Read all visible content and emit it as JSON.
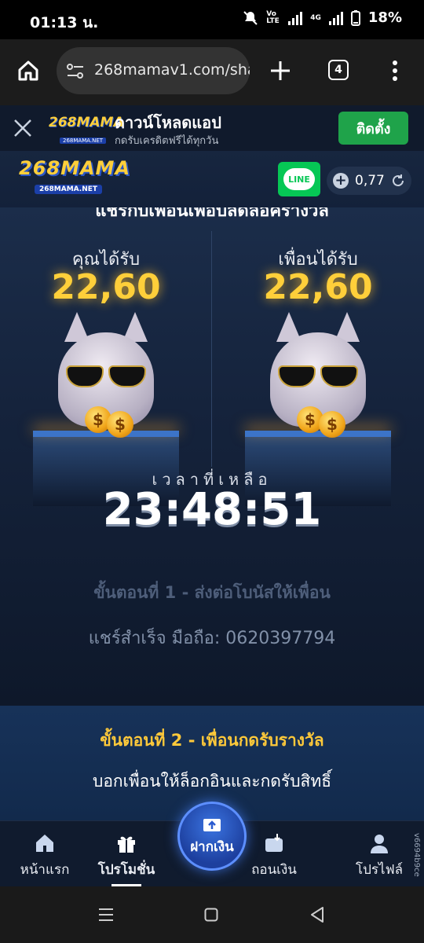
{
  "status_bar": {
    "time": "01:13 น.",
    "battery": "18%",
    "network": "4G",
    "carrier_mark": "Vo LTE"
  },
  "browser": {
    "url": "268mamav1.com/sha",
    "tab_count": "4"
  },
  "app_banner": {
    "title": "ดาวน์โหลดแอป",
    "subtitle": "กดรับเครดิตฟรีได้ทุกวัน",
    "install_label": "ติดตั้ง",
    "logo_text": "268MAMA",
    "logo_sub": "268MAMA.NET"
  },
  "header": {
    "logo_text": "268MAMA",
    "logo_sub": "268MAMA.NET",
    "line_label": "LINE",
    "balance": "0,77"
  },
  "main": {
    "cut_title": "แชร์กับเพื่อนเพื่อปลดล็อครางวัล",
    "you_label": "คุณได้รับ",
    "you_amount": "22,60",
    "friend_label": "เพื่อนได้รับ",
    "friend_amount": "22,60",
    "time_left_label": "เวลาที่เหลือ",
    "countdown": "23:48:51",
    "step1": "ขั้นตอนที่ 1 - ส่งต่อโบนัสให้เพื่อน",
    "share_status": "แชร์สำเร็จ มือถือ: 0620397794"
  },
  "step2": {
    "title": "ขั้นตอนที่ 2 - เพื่อนกดรับรางวัล",
    "desc": "บอกเพื่อนให้ล็อกอินและกดรับสิทธิ์"
  },
  "bottom_nav": {
    "home": "หน้าแรก",
    "promo": "โปรโมชั่น",
    "deposit": "ฝากเงิน",
    "withdraw": "ถอนเงิน",
    "profile": "โปรไฟล์"
  },
  "version": "v6694b9ce",
  "colors": {
    "gold": "#ffcf3a",
    "line_green": "#06c755",
    "install_green": "#1fa34a",
    "deposit_blue": "#2a5bd0"
  }
}
